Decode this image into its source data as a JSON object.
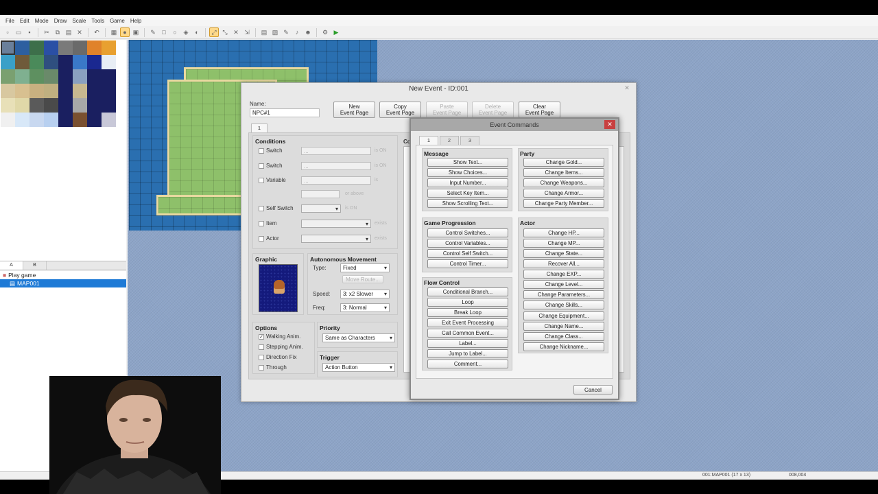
{
  "menu": [
    "File",
    "Edit",
    "Mode",
    "Draw",
    "Scale",
    "Tools",
    "Game",
    "Help"
  ],
  "layer_tabs": [
    "A",
    "B"
  ],
  "tree": {
    "root": "Play game",
    "map": "MAP001"
  },
  "status": {
    "map_info": "001:MAP001 (17 x 13)",
    "coords": "008,004"
  },
  "event_dialog": {
    "title": "New Event - ID:001",
    "name_label": "Name:",
    "name_value": "NPC#1",
    "page_buttons": [
      {
        "l1": "New",
        "l2": "Event Page",
        "enabled": true
      },
      {
        "l1": "Copy",
        "l2": "Event Page",
        "enabled": true
      },
      {
        "l1": "Paste",
        "l2": "Event Page",
        "enabled": false
      },
      {
        "l1": "Delete",
        "l2": "Event Page",
        "enabled": false
      },
      {
        "l1": "Clear",
        "l2": "Event Page",
        "enabled": true
      }
    ],
    "page_tab": "1",
    "conditions": {
      "title": "Conditions",
      "rows": [
        {
          "label": "Switch",
          "suffix": "is ON"
        },
        {
          "label": "Switch",
          "suffix": "is ON"
        },
        {
          "label": "Variable",
          "suffix": "is"
        },
        {
          "label": "",
          "suffix": "or above"
        },
        {
          "label": "Self Switch",
          "suffix": "is ON"
        },
        {
          "label": "Item",
          "suffix": "exists"
        },
        {
          "label": "Actor",
          "suffix": "exists"
        }
      ]
    },
    "graphic": {
      "title": "Graphic"
    },
    "movement": {
      "title": "Autonomous Movement",
      "type_label": "Type:",
      "type_value": "Fixed",
      "move_route": "Move Route...",
      "speed_label": "Speed:",
      "speed_value": "3: x2 Slower",
      "freq_label": "Freq:",
      "freq_value": "3: Normal"
    },
    "options": {
      "title": "Options",
      "items": [
        {
          "label": "Walking Anim.",
          "checked": true
        },
        {
          "label": "Stepping Anim.",
          "checked": false
        },
        {
          "label": "Direction Fix",
          "checked": false
        },
        {
          "label": "Through",
          "checked": false
        }
      ]
    },
    "priority": {
      "title": "Priority",
      "value": "Same as Characters"
    },
    "trigger": {
      "title": "Trigger",
      "value": "Action Button"
    },
    "contents_label_partial": "Co"
  },
  "commands": {
    "title": "Event Commands",
    "tabs": [
      "1",
      "2",
      "3"
    ],
    "message": {
      "title": "Message",
      "buttons": [
        "Show Text...",
        "Show Choices...",
        "Input Number...",
        "Select Key Item...",
        "Show Scrolling Text..."
      ]
    },
    "progression": {
      "title": "Game Progression",
      "buttons": [
        "Control Switches...",
        "Control Variables...",
        "Control Self Switch...",
        "Control Timer..."
      ]
    },
    "flow": {
      "title": "Flow Control",
      "buttons": [
        "Conditional Branch...",
        "Loop",
        "Break Loop",
        "Exit Event Processing",
        "Call Common Event...",
        "Label...",
        "Jump to Label...",
        "Comment..."
      ]
    },
    "party": {
      "title": "Party",
      "buttons": [
        "Change Gold...",
        "Change Items...",
        "Change Weapons...",
        "Change Armor...",
        "Change Party Member..."
      ]
    },
    "actor": {
      "title": "Actor",
      "buttons": [
        "Change HP...",
        "Change MP...",
        "Change State...",
        "Recover All...",
        "Change EXP...",
        "Change Level...",
        "Change Parameters...",
        "Change Skills...",
        "Change Equipment...",
        "Change Name...",
        "Change Class...",
        "Change Nickname..."
      ]
    },
    "cancel": "Cancel"
  },
  "colors": {
    "selection": "#1e7ad6",
    "water": "#2a6fb0",
    "grass": "#8ec06a",
    "close_red": "#c84040"
  }
}
